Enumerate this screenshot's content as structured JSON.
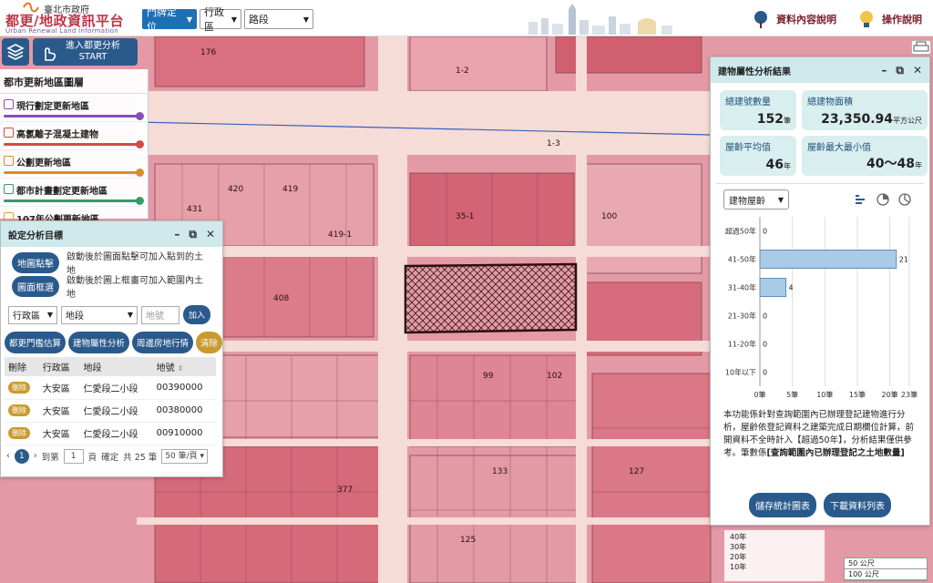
{
  "header": {
    "gov": "臺北市政府",
    "title": "都更/地政資訊平台",
    "subtitle_en": "Urban Renewal Land Information",
    "location_mode": "門牌定位",
    "district_sel": "行政區",
    "road_sel": "路段",
    "data_desc": "資料內容說明",
    "manual": "操作說明"
  },
  "tools": {
    "start_line1": "進入都更分析",
    "start_line2": "START"
  },
  "layers": {
    "title": "都市更新地區圖層",
    "items": [
      {
        "label": "現行劃定更新地區",
        "color": "#8a4fb5"
      },
      {
        "label": "高氯離子混凝土建物",
        "color": "#d14b4b"
      },
      {
        "label": "公劃更新地區",
        "color": "#e08a2c"
      },
      {
        "label": "都市計畫劃定更新地區",
        "color": "#3a9a6a"
      },
      {
        "label": "107年公劃更新地區",
        "color": "#d9a23a"
      }
    ]
  },
  "analysis": {
    "title": "設定分析目標",
    "point_btn": "地圖點擊",
    "point_desc": "啟動後於圖面點擊可加入點到的土地",
    "box_btn": "圖面框選",
    "box_desc": "啟動後於圖上框畫可加入範圍內土地",
    "district_sel": "行政區",
    "section_sel": "地段",
    "lot_placeholder": "地號",
    "add": "加入",
    "actions": [
      "都更門檻估算",
      "建物屬性分析",
      "周邊房地行情"
    ],
    "clear": "清除",
    "columns": [
      "刪除",
      "行政區",
      "地段",
      "地號"
    ],
    "rows": [
      {
        "del": "刪除",
        "district": "大安區",
        "section": "仁愛段二小段",
        "lot": "00390000"
      },
      {
        "del": "刪除",
        "district": "大安區",
        "section": "仁愛段二小段",
        "lot": "00380000"
      },
      {
        "del": "刪除",
        "district": "大安區",
        "section": "仁愛段二小段",
        "lot": "00910000"
      }
    ],
    "pager": {
      "page": "1",
      "to_label": "到第",
      "page_input": "1",
      "page_unit": "頁",
      "confirm": "確定",
      "total": "共 25 筆",
      "per_page": "50 筆/頁"
    }
  },
  "result": {
    "title": "建物屬性分析結果",
    "stats": [
      {
        "key": "總建號數量",
        "value": "152",
        "unit": "筆"
      },
      {
        "key": "總建物面積",
        "value": "23,350.94",
        "unit": "平方公尺"
      },
      {
        "key": "屋齡平均值",
        "value": "46",
        "unit": "年"
      },
      {
        "key": "屋齡最大最小值",
        "value": "40～48",
        "unit": "年"
      }
    ],
    "chart_selector": "建物屋齡",
    "note_plain": "本功能係針對查詢範圍內已辦理登記建物進行分析，屋齡依登記資料之建築完成日期欄位計算，前開資料不全時計入【超過50年】，分析結果僅供參考。筆數係",
    "note_bold": "[查詢範圍內已辦理登記之土地數量]",
    "btn_save": "儲存統計圖表",
    "btn_download": "下載資料列表"
  },
  "chart_data": {
    "type": "bar",
    "orientation": "horizontal",
    "categories": [
      "超過50年",
      "41-50年",
      "31-40年",
      "21-30年",
      "11-20年",
      "10年以下"
    ],
    "values": [
      0,
      21,
      4,
      0,
      0,
      0
    ],
    "xticks": [
      "0筆",
      "5筆",
      "10筆",
      "15筆",
      "20筆",
      "23筆"
    ],
    "xlim": [
      0,
      23
    ],
    "bar_color": "#a9cbe6",
    "grid": true
  },
  "legend": {
    "items": [
      "40年",
      "30年",
      "20年",
      "10年"
    ],
    "boxes": [
      "50 公尺",
      "100 公尺"
    ]
  }
}
